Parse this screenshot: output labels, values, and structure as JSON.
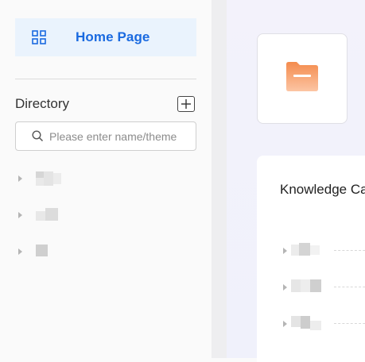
{
  "sidebar": {
    "home_label": "Home Page",
    "directory_title": "Directory",
    "search": {
      "placeholder": "Please enter name/theme",
      "value": ""
    },
    "tree_items": [
      "",
      "",
      ""
    ]
  },
  "main": {
    "knowledge_title": "Knowledge Ca",
    "list_items": [
      "",
      "",
      ""
    ]
  },
  "colors": {
    "accent": "#1a6ae0",
    "home_bg": "#eaf3fd",
    "folder": "#f58a4a"
  },
  "icons": {
    "home": "grid-icon",
    "add": "plus-icon",
    "search": "search-icon",
    "folder": "folder-icon",
    "caret": "caret-right-icon"
  }
}
